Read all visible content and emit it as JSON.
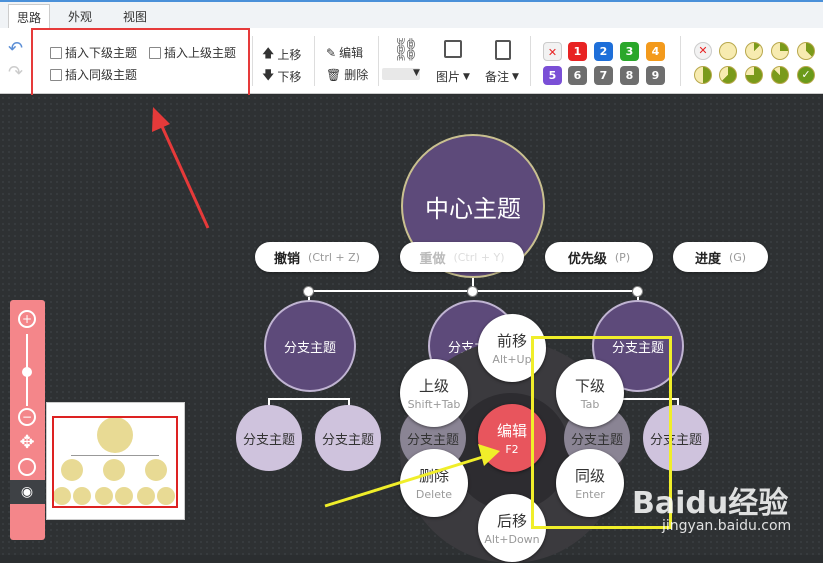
{
  "tabs": [
    {
      "label": "思路",
      "active": true
    },
    {
      "label": "外观",
      "active": false
    },
    {
      "label": "视图",
      "active": false
    }
  ],
  "toolbar": {
    "insert_child": "插入下级主题",
    "insert_parent": "插入上级主题",
    "insert_sibling": "插入同级主题",
    "move_up": "上移",
    "move_down": "下移",
    "edit": "编辑",
    "delete": "删除",
    "image": "图片",
    "note": "备注",
    "priorities": [
      "1",
      "2",
      "3",
      "4",
      "5",
      "6",
      "7",
      "8",
      "9"
    ],
    "priority_colors": [
      "#e82323",
      "#1e6fd9",
      "#2aa72a",
      "#f39a1c",
      "#7a4fd6",
      "#6e6e6e",
      "#6e6e6e",
      "#6e6e6e",
      "#6e6e6e"
    ]
  },
  "canvas": {
    "center_topic": "中心主题",
    "branch_label": "分支主题",
    "hint_pills": [
      {
        "label": "撤销",
        "shortcut": "(Ctrl + Z)"
      },
      {
        "label": "重做",
        "shortcut": "(Ctrl + Y)"
      },
      {
        "label": "优先级",
        "shortcut": "(P)"
      },
      {
        "label": "进度",
        "shortcut": "(G)"
      }
    ],
    "radial_menu": {
      "forward": {
        "label": "前移",
        "key": "Alt+Up"
      },
      "up": {
        "label": "上级",
        "key": "Shift+Tab"
      },
      "down": {
        "label": "下级",
        "key": "Tab"
      },
      "edit": {
        "label": "编辑",
        "key": "F2"
      },
      "delete": {
        "label": "删除",
        "key": "Delete"
      },
      "sibling": {
        "label": "同级",
        "key": "Enter"
      },
      "backward": {
        "label": "后移",
        "key": "Alt+Down"
      }
    }
  },
  "watermark": {
    "brand": "Baidu经验",
    "url": "jingyan.baidu.com"
  },
  "colors": {
    "accent_red": "#e63a3a",
    "highlight_yellow": "#f0ee2a",
    "node_purple": "#5d4a7a",
    "zoom_panel": "#f4868a"
  }
}
